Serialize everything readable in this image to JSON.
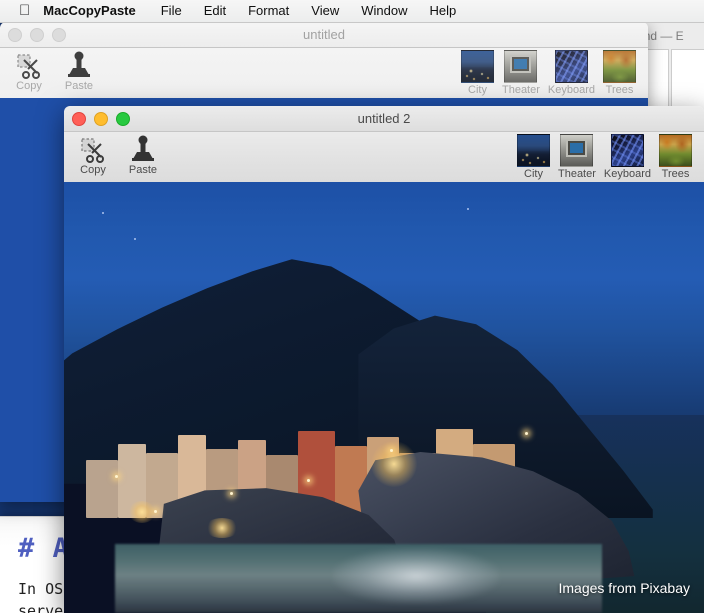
{
  "menubar": {
    "apple_icon": "apple-icon",
    "app_name": "MacCopyPaste",
    "items": [
      {
        "label": "File"
      },
      {
        "label": "Edit"
      },
      {
        "label": "Format"
      },
      {
        "label": "View"
      },
      {
        "label": "Window"
      },
      {
        "label": "Help"
      }
    ]
  },
  "background": {
    "editor_window_title": "x.md — E",
    "markdown": {
      "heading": "# A",
      "line1": "In OS",
      "line2": "serve"
    }
  },
  "window1": {
    "title": "untitled",
    "state": "inactive",
    "toolbar": {
      "copy_label": "Copy",
      "paste_label": "Paste",
      "thumbs": [
        {
          "label": "City",
          "icon": "city-thumbnail"
        },
        {
          "label": "Theater",
          "icon": "theater-thumbnail"
        },
        {
          "label": "Keyboard",
          "icon": "keyboard-thumbnail"
        },
        {
          "label": "Trees",
          "icon": "trees-thumbnail"
        }
      ]
    }
  },
  "window2": {
    "title": "untitled 2",
    "state": "active",
    "toolbar": {
      "copy_label": "Copy",
      "paste_label": "Paste",
      "thumbs": [
        {
          "label": "City",
          "icon": "city-thumbnail"
        },
        {
          "label": "Theater",
          "icon": "theater-thumbnail"
        },
        {
          "label": "Keyboard",
          "icon": "keyboard-thumbnail"
        },
        {
          "label": "Trees",
          "icon": "trees-thumbnail"
        }
      ]
    },
    "photo": {
      "caption": "Images from Pixabay",
      "subject": "manarola-cinque-terre-at-blue-hour"
    }
  },
  "colors": {
    "desktop_blue": "#1f4fa8",
    "titlebar": "#e4e4e4",
    "close": "#ff5f57",
    "minimize": "#ffbd2e",
    "zoom": "#28c940",
    "md_heading": "#4f5fc0"
  }
}
